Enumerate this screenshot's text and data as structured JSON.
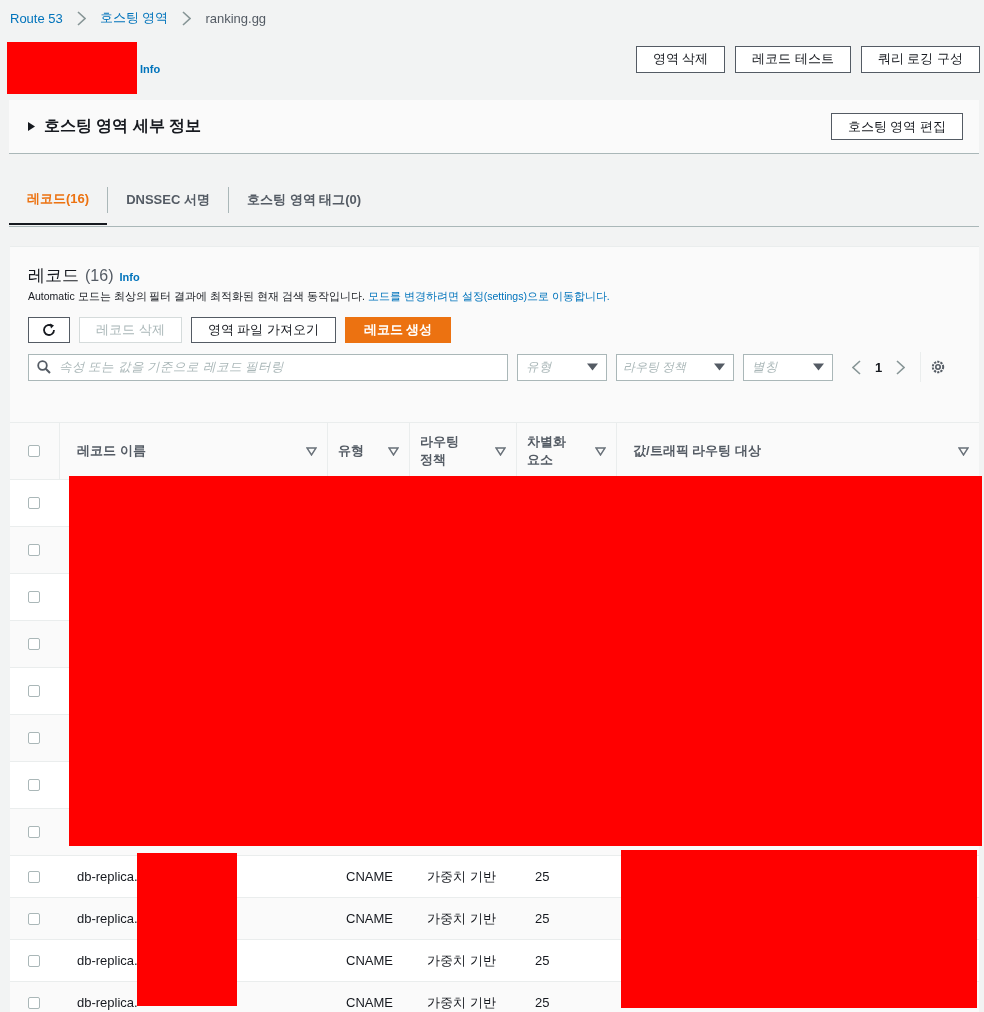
{
  "breadcrumbs": [
    {
      "label": "Route 53",
      "link": true
    },
    {
      "label": "호스팅 영역",
      "link": true
    },
    {
      "label": "ranking.gg",
      "link": false
    }
  ],
  "header": {
    "info": "Info",
    "buttons": [
      "영역 삭제",
      "레코드 테스트",
      "쿼리 로깅 구성"
    ]
  },
  "details": {
    "title": "호스팅 영역 세부 정보",
    "expanded": false,
    "edit_button": "호스팅 영역 편집"
  },
  "tabs": [
    {
      "label": "레코드(16)",
      "selected": true
    },
    {
      "label": "DNSSEC 서명",
      "selected": false
    },
    {
      "label": "호스팅 영역 태그(0)",
      "selected": false
    }
  ],
  "records": {
    "title": "레코드",
    "count": "(16)",
    "info": "Info",
    "description": "Automatic 모드는 최상의 필터 결과에 최적화된 현재 검색 동작입니다.",
    "description_link": "모드를 변경하려면 설정(settings)으로 이동합니다.",
    "actions": [
      {
        "label": "레코드 삭제",
        "kind": "normal",
        "disabled": true
      },
      {
        "label": "영역 파일 가져오기",
        "kind": "normal",
        "disabled": false
      },
      {
        "label": "레코드 생성",
        "kind": "primary",
        "disabled": false
      }
    ],
    "search": {
      "placeholder": "속성 또는 값을 기준으로 레코드 필터링"
    },
    "filters": [
      {
        "placeholder": "유형"
      },
      {
        "placeholder": "라우팅 정책"
      },
      {
        "placeholder": "별칭"
      }
    ],
    "page": "1",
    "select_all_checked": false,
    "columns": [
      "레코드 이름",
      "유형",
      "라우팅 정책",
      "차별화 요소",
      "값/트래픽 라우팅 대상"
    ],
    "rows": [
      {
        "checked": false
      },
      {
        "checked": false
      },
      {
        "checked": false
      },
      {
        "checked": false
      },
      {
        "checked": false
      },
      {
        "checked": false
      },
      {
        "checked": false
      },
      {
        "checked": false
      },
      {
        "checked": false,
        "name": "db-replica.",
        "type": "CNAME",
        "policy": "가중치 기반",
        "differentiator": "25"
      },
      {
        "checked": false,
        "name": "db-replica.",
        "type": "CNAME",
        "policy": "가중치 기반",
        "differentiator": "25"
      },
      {
        "checked": false,
        "name": "db-replica.",
        "type": "CNAME",
        "policy": "가중치 기반",
        "differentiator": "25"
      },
      {
        "checked": false,
        "name": "db-replica.",
        "type": "CNAME",
        "policy": "가중치 기반",
        "differentiator": "25"
      }
    ]
  }
}
